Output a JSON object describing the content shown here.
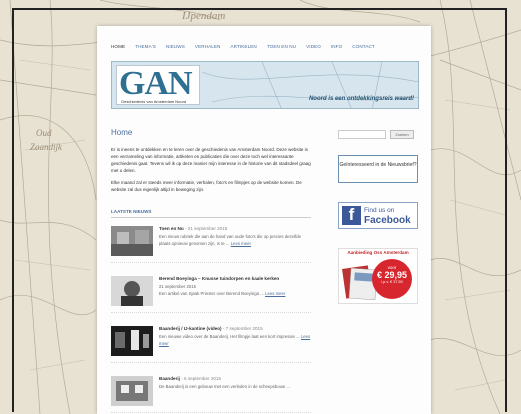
{
  "nav": [
    "HOME",
    "THEMA'S",
    "NIEUWS",
    "VERHALEN",
    "ARTIKELEN",
    "TOEN EN NU",
    "VIDEO",
    "INFO",
    "CONTACT"
  ],
  "banner": {
    "logo": "GAN",
    "logo_sub": "Geschiedenis van Amsterdam Noord",
    "slogan": "Noord is een ontdekkingsreis waard!"
  },
  "map_words": {
    "top": "IJpendam",
    "left1": "Oud",
    "left2": "Zaandijk"
  },
  "home": {
    "title": "Home",
    "paragraphs": [
      "Er is ineens te ontdekken en te leren over de geschiedenis van Amsterdam Noord. Deze website is een verzameling van informatie, artikelen en publicaties die over deze toch wel interessante geschiedenis gaat. Tevens wil ik op deze manier mijn interesse in de historie van dit stadsdeel graag met u delen.",
      "Elke maand zal er steeds meer informatie, verhalen, foto's en filmpjes op de website komen. De website zal dus eigenlijk altijd in beweging zijn."
    ]
  },
  "latest": {
    "header": "LAATSTE NIEUWS",
    "items": [
      {
        "title": "Toen en Nu",
        "date": "- 21 september 2015",
        "text": "Een nieuw rubriek die aan de hand van oude foto's die op precies dezelfde plaats opnieuw genomen zijn, is te ...",
        "more": "Lees meer"
      },
      {
        "title": "Berend Boeyinga – Knusse tuindorpen en kaale kerken",
        "date": "",
        "text": "21 september 2015",
        "text2": "Een artikel van Sjaak Priester over Berend Boeyinga ...",
        "more": "Lees meer"
      },
      {
        "title": "Baanderij / IJ-kantine (video)",
        "date": "- 7 september 2015",
        "text": "Een nieuwe video over de Baanderij. Het filmpje laat een kort impressie ...",
        "more": "Lees meer"
      },
      {
        "title": "Baanderij",
        "date": "- 6 september 2015",
        "text": "De Baanderij is een gebouw met een verleden in de scheepsbouw ...",
        "more": ""
      }
    ]
  },
  "sidebar": {
    "search_placeholder": "",
    "search_button": "Zoeken",
    "interest": "Geïnteresseerd in de Nieuwsbrief?",
    "fb_small": "Find us on",
    "fb_big": "Facebook",
    "promo_title": "Aanbieding Oss Amsterdam",
    "badge_line1": "voor",
    "badge_price": "€ 29,95",
    "badge_line3": "i.p.v. € 37,50"
  }
}
